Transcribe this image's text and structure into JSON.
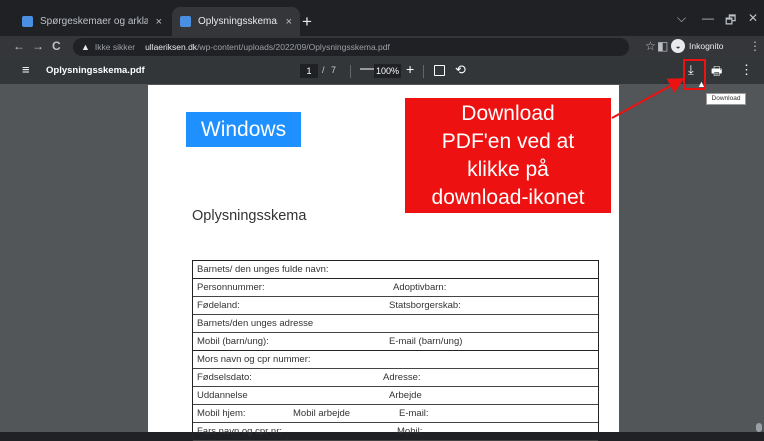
{
  "tabs": [
    {
      "title": "Spørgeskemaer og arklæringer",
      "close": "×"
    },
    {
      "title": "Oplysningsskema.pdf",
      "close": "×"
    }
  ],
  "new_tab": "+",
  "window_controls": {
    "menu": "⌵",
    "minimize": "—",
    "restore": "🗗",
    "close": "✕"
  },
  "nav": {
    "back": "←",
    "forward": "→",
    "reload": "C"
  },
  "address": {
    "warning": "▲",
    "security": "Ikke sikker",
    "domain": "ullaeriksen.dk",
    "path": "/wp-content/uploads/2022/09/Oplysningsskema.pdf",
    "star": "☆"
  },
  "browser": {
    "extension": "◧",
    "incognito_label": "Inkognito",
    "incognito_icon": "◒",
    "menu": "⋮"
  },
  "pdf_toolbar": {
    "menu_icon": "≡",
    "file_name": "Oplysningsskema.pdf",
    "current_page": "1",
    "page_sep": "/",
    "total_pages": "7",
    "zoom_minus": "—",
    "zoom": "100%",
    "zoom_plus": "+",
    "rotate": "⟲",
    "download": "⤓",
    "print": "🖶",
    "more": "⋮"
  },
  "document": {
    "windows_label": "Windows",
    "form_title": "Oplysningsskema",
    "rows": [
      {
        "cells": [
          "Barnets/ den unges fulde navn:"
        ]
      },
      {
        "cells": [
          "Personnummer:",
          "Adoptivbarn:"
        ]
      },
      {
        "cells": [
          "Fødeland:",
          "Statsborgerskab:"
        ]
      },
      {
        "cells": [
          "Barnets/den unges adresse"
        ]
      },
      {
        "cells": [
          "Mobil (barn/ung):",
          "E-mail (barn/ung)"
        ]
      },
      {
        "cells": [
          "Mors navn og cpr nummer:"
        ]
      },
      {
        "cells": [
          "Fødselsdato:",
          "Adresse:"
        ]
      },
      {
        "cells": [
          "Uddannelse",
          "Arbejde"
        ]
      },
      {
        "cells": [
          "Mobil hjem:",
          "Mobil arbejde",
          "E-mail:"
        ]
      },
      {
        "cells": [
          "Fars navn og cpr nr:",
          "Mobil:"
        ]
      }
    ]
  },
  "annotation": {
    "lines": [
      "Download",
      "PDF'en ved at",
      "klikke på",
      "download-ikonet"
    ],
    "color": "#ee1111"
  },
  "tooltip": "Download",
  "colors": {
    "chrome_dark": "#202124",
    "chrome_mid": "#35363a",
    "pdf_bar": "#323639",
    "viewer_bg": "#525659",
    "windows_blue": "#1e90ff"
  }
}
